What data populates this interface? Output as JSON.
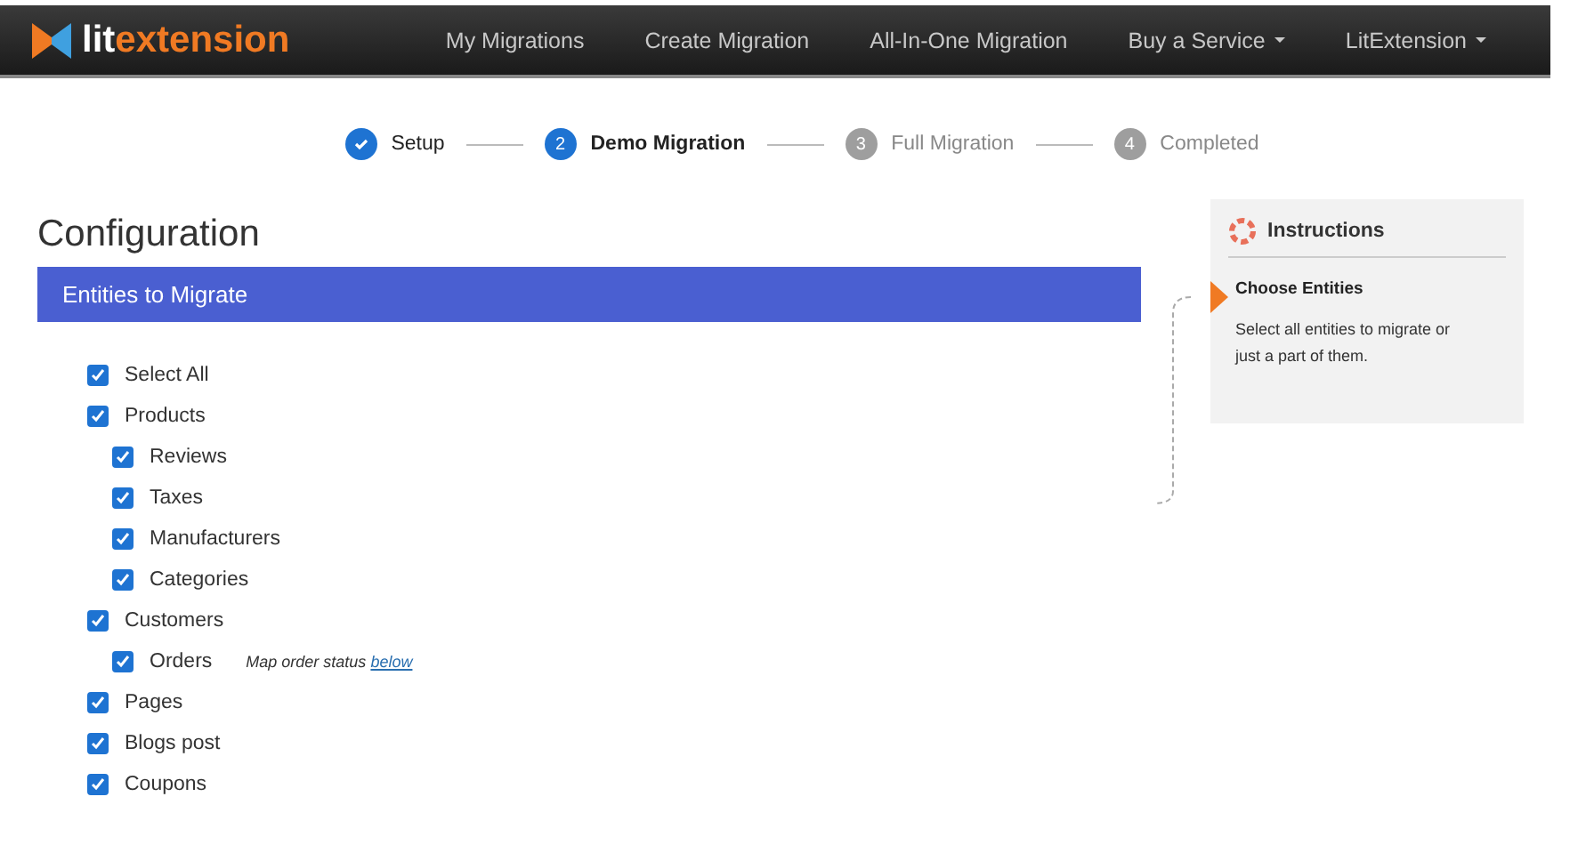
{
  "navbar": {
    "logo": {
      "start": "lit",
      "end": "extension"
    },
    "items": [
      {
        "label": "My Migrations",
        "dropdown": false
      },
      {
        "label": "Create Migration",
        "dropdown": false
      },
      {
        "label": "All-In-One Migration",
        "dropdown": false
      },
      {
        "label": "Buy a Service",
        "dropdown": true
      },
      {
        "label": "LitExtension",
        "dropdown": true
      }
    ]
  },
  "steps": [
    {
      "label": "Setup",
      "done": true,
      "selected": false
    },
    {
      "number": "2",
      "label": "Demo Migration",
      "done": false,
      "selected": true
    },
    {
      "number": "3",
      "label": "Full Migration",
      "done": false,
      "selected": false
    },
    {
      "number": "4",
      "label": "Completed",
      "done": false,
      "selected": false
    }
  ],
  "title": "Configuration",
  "section": {
    "title": "Entities to Migrate"
  },
  "entities": [
    {
      "label": "Select All",
      "checked": true
    },
    {
      "label": "Products",
      "checked": true,
      "children": [
        {
          "label": "Reviews",
          "checked": true
        },
        {
          "label": "Taxes",
          "checked": true
        },
        {
          "label": "Manufacturers",
          "checked": true
        },
        {
          "label": "Categories",
          "checked": true
        }
      ]
    },
    {
      "label": "Customers",
      "checked": true,
      "children": [
        {
          "label": "Orders",
          "checked": true,
          "note": "Map order status",
          "link": "below"
        }
      ]
    },
    {
      "label": "Pages",
      "checked": true
    },
    {
      "label": "Blogs post",
      "checked": true
    },
    {
      "label": "Coupons",
      "checked": true
    }
  ],
  "instructions": {
    "title": "Instructions",
    "heading": "Choose Entities",
    "text": "Select all entities to migrate or just a part of them."
  }
}
